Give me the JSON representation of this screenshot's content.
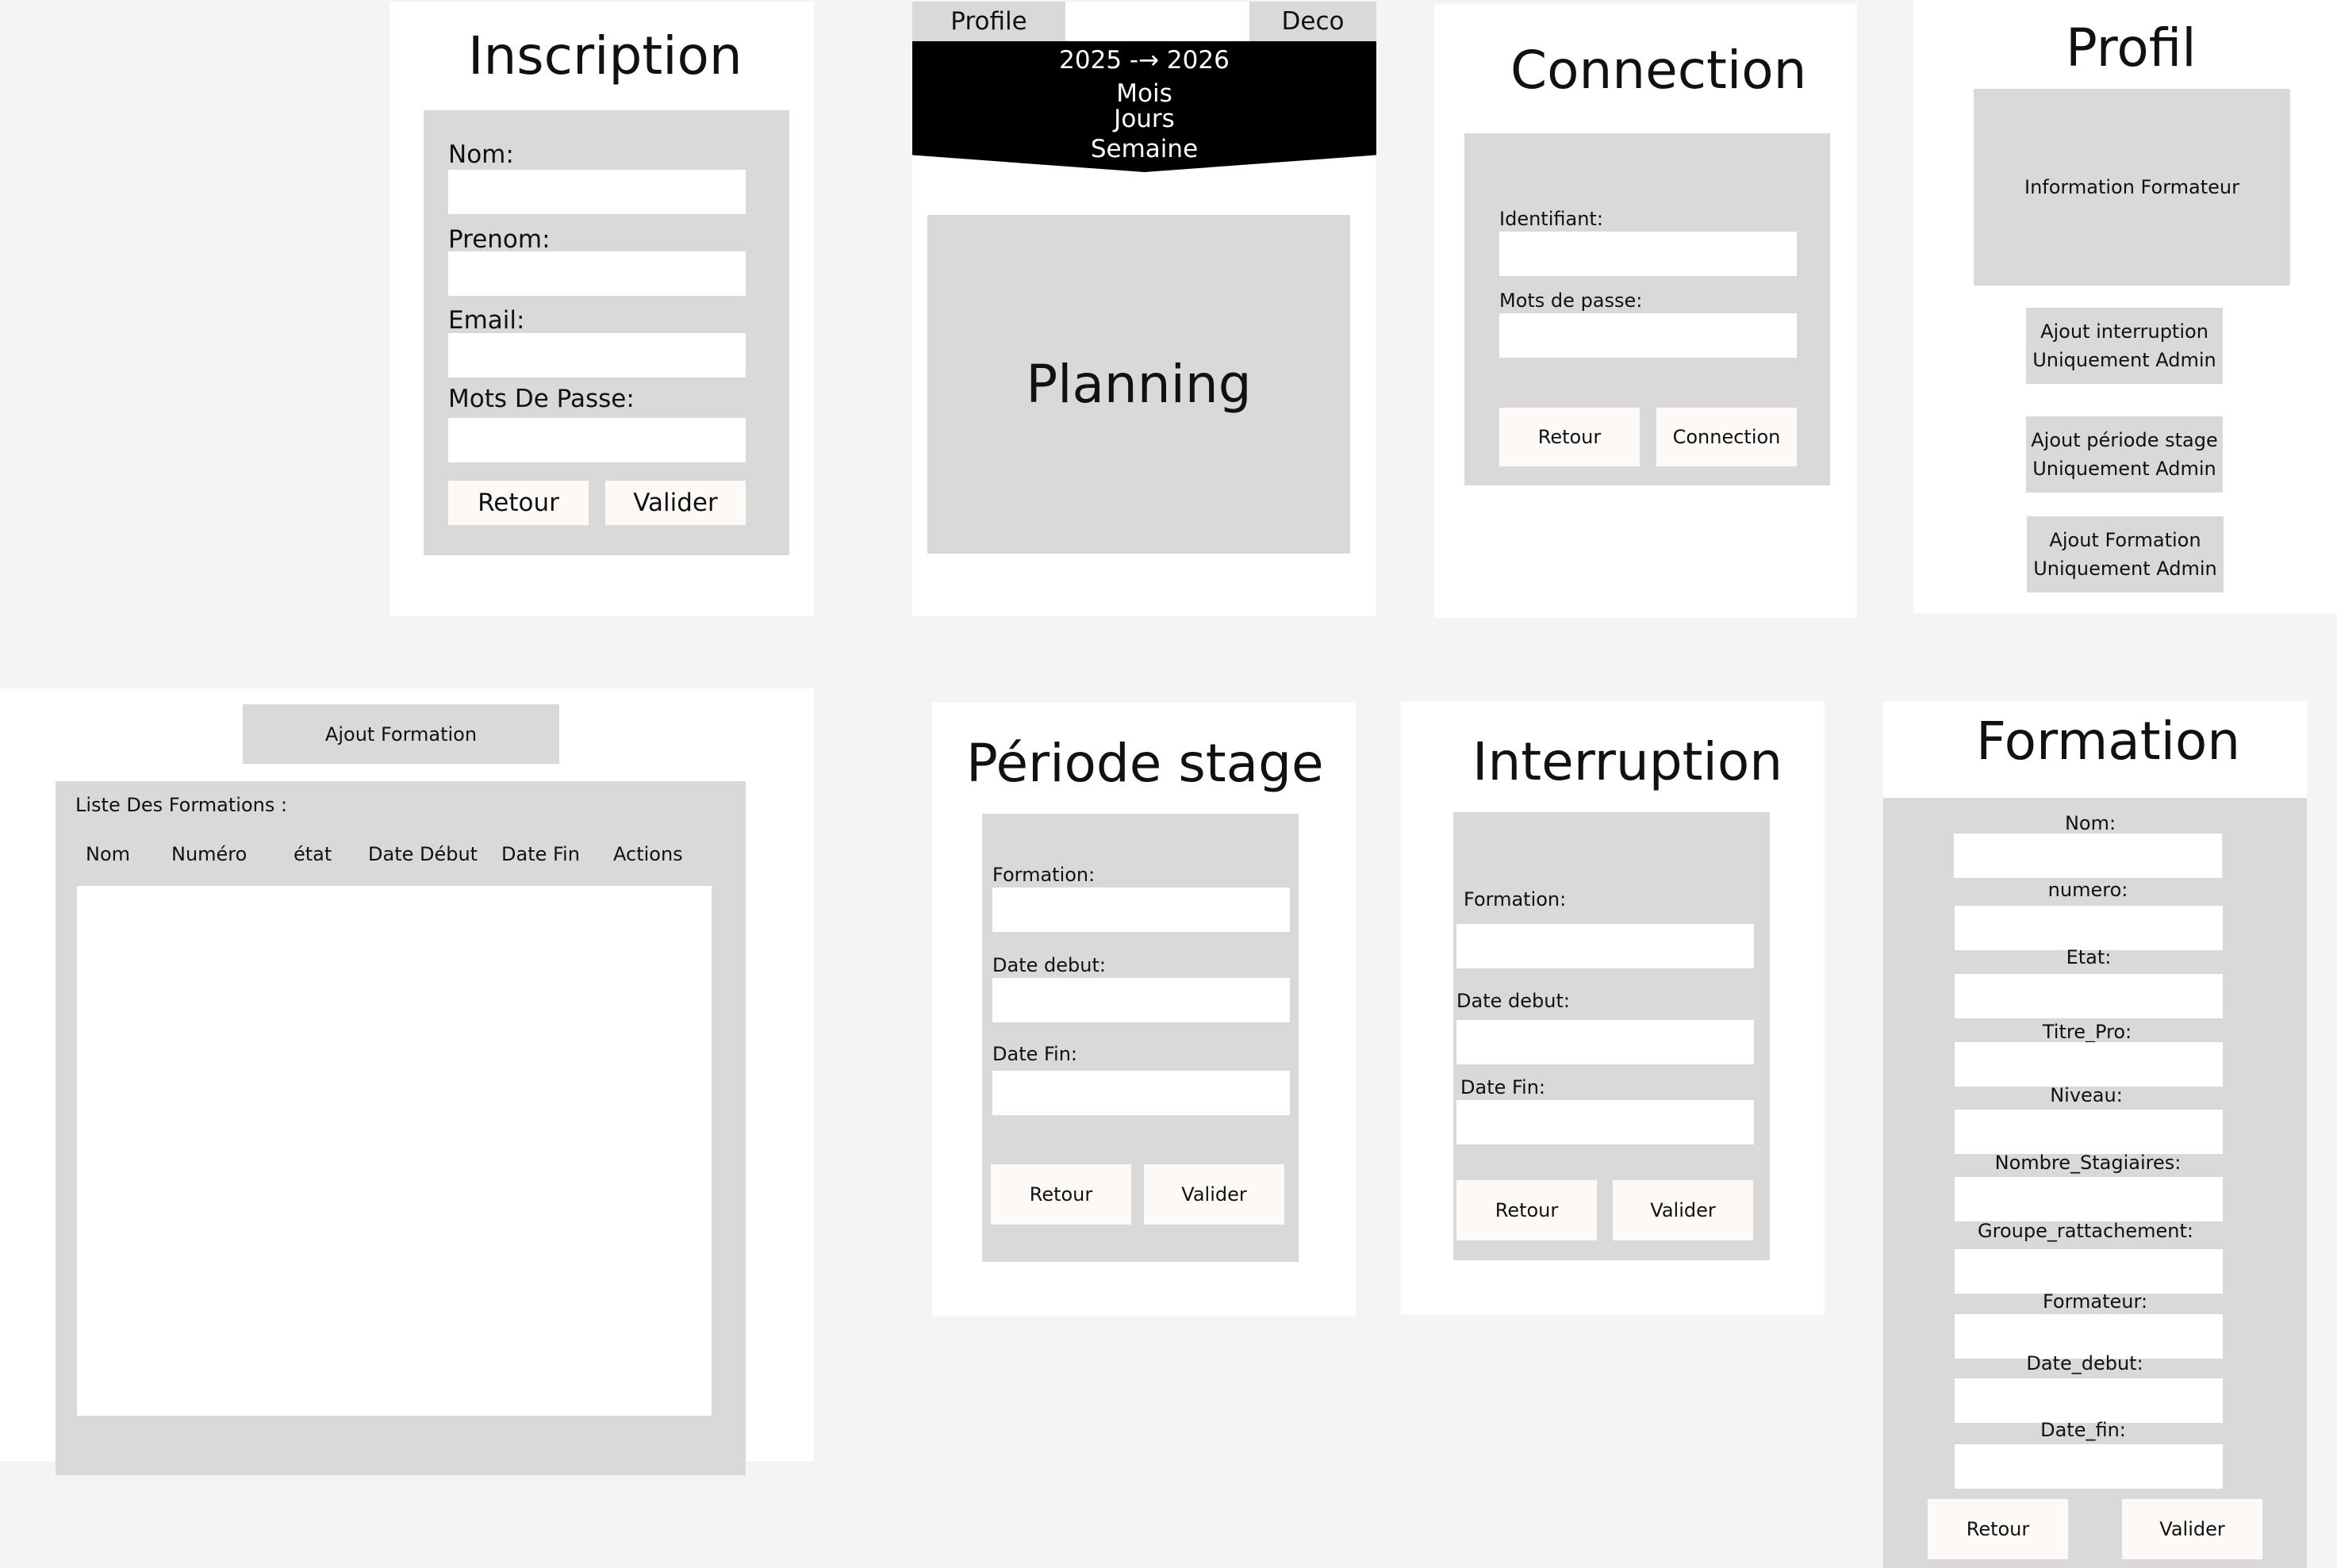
{
  "inscription": {
    "title": "Inscription",
    "labels": {
      "nom": "Nom:",
      "prenom": "Prenom:",
      "email": "Email:",
      "password": "Mots De Passe:"
    },
    "buttons": {
      "back": "Retour",
      "submit": "Valider"
    }
  },
  "planning": {
    "profile_tab": "Profile",
    "logout_tab": "Deco",
    "year_range": "2025 -→ 2026",
    "views": [
      "Mois",
      "Jours",
      "Semaine"
    ],
    "main_label": "Planning"
  },
  "connection": {
    "title": "Connection",
    "labels": {
      "login": "Identifiant:",
      "password": "Mots de passe:"
    },
    "buttons": {
      "back": "Retour",
      "submit": "Connection"
    }
  },
  "profil": {
    "title": "Profil",
    "info_box": "Information Formateur",
    "actions": [
      {
        "line1": "Ajout interruption",
        "line2": "Uniquement Admin"
      },
      {
        "line1": "Ajout période stage",
        "line2": "Uniquement Admin"
      },
      {
        "line1": "Ajout Formation",
        "line2": "Uniquement Admin"
      }
    ]
  },
  "formations_list": {
    "add_button": "Ajout Formation",
    "list_title": "Liste Des Formations :",
    "columns": [
      "Nom",
      "Numéro",
      "état",
      "Date Début",
      "Date Fin",
      "Actions"
    ]
  },
  "periode_stage": {
    "title": "Période stage",
    "labels": {
      "formation": "Formation:",
      "start": "Date debut:",
      "end": "Date Fin:"
    },
    "buttons": {
      "back": "Retour",
      "submit": "Valider"
    }
  },
  "interruption": {
    "title": "Interruption",
    "labels": {
      "formation": "Formation:",
      "start": "Date debut:",
      "end": "Date Fin:"
    },
    "buttons": {
      "back": "Retour",
      "submit": "Valider"
    }
  },
  "formation": {
    "title": "Formation",
    "fields": [
      "Nom:",
      "numero:",
      "Etat:",
      "Titre_Pro:",
      "Niveau:",
      "Nombre_Stagiaires:",
      "Groupe_rattachement:",
      "Formateur:",
      "Date_debut:",
      "Date_fin:"
    ],
    "buttons": {
      "back": "Retour",
      "submit": "Valider"
    }
  }
}
